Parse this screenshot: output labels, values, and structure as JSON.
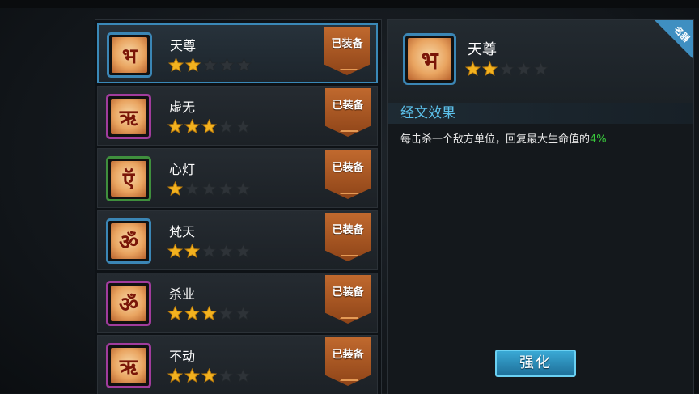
{
  "equipped_label": "已装备",
  "items": [
    {
      "name": "天尊",
      "glyph": "भ",
      "stars": 2,
      "frame": "blue",
      "selected": true
    },
    {
      "name": "虚无",
      "glyph": "ऋ",
      "stars": 3,
      "frame": "purple",
      "selected": false
    },
    {
      "name": "心灯",
      "glyph": "ऍ",
      "stars": 1,
      "frame": "green",
      "selected": false
    },
    {
      "name": "梵天",
      "glyph": "ॐ",
      "stars": 2,
      "frame": "blue",
      "selected": false
    },
    {
      "name": "杀业",
      "glyph": "ॐ",
      "stars": 3,
      "frame": "purple",
      "selected": false
    },
    {
      "name": "不动",
      "glyph": "ऋ",
      "stars": 3,
      "frame": "purple",
      "selected": false
    }
  ],
  "max_stars": 5,
  "detail": {
    "name": "天尊",
    "glyph": "भ",
    "stars": 2,
    "corner_tag": "名器",
    "effect_title": "经文效果",
    "effect_text": "每击杀一个敌方单位，回复最大生命值的",
    "effect_value": "4%"
  },
  "enhance_button": "强化",
  "colors": {
    "star_filled": "#f3b21f",
    "star_empty": "#2e3338",
    "frame_blue": "#3b86b5",
    "frame_purple": "#a13c9d",
    "frame_green": "#3f8f3d",
    "highlight_green": "#39c93c",
    "title_blue": "#5cc0ea"
  }
}
